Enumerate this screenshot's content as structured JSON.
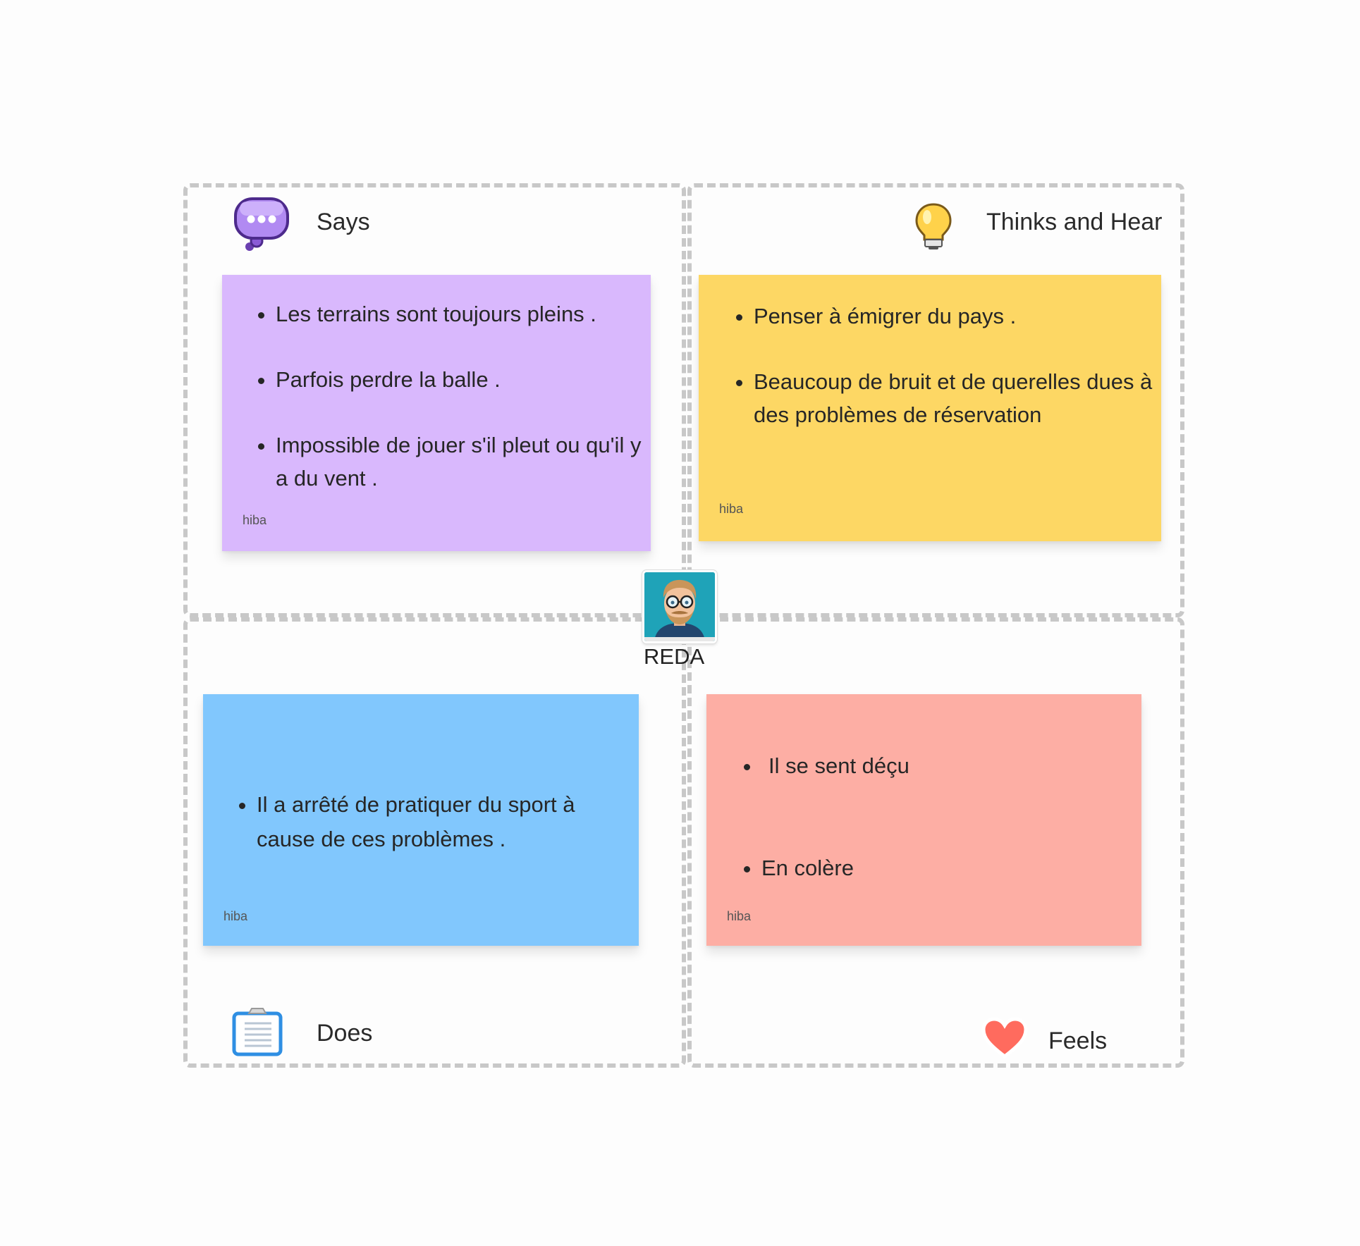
{
  "persona": {
    "name": "REDA",
    "avatar_icon": "man-with-glasses-avatar"
  },
  "quadrants": {
    "says": {
      "label": "Says",
      "icon": "speech-bubble-icon",
      "sticky": {
        "color": "#d9b8fd",
        "items": [
          "Les terrains sont toujours pleins .",
          "Parfois perdre la balle .",
          "Impossible de jouer s'il pleut ou qu'il y a du vent ."
        ],
        "author": "hiba"
      }
    },
    "thinks": {
      "label": "Thinks and Hear",
      "icon": "lightbulb-icon",
      "sticky": {
        "color": "#fdd764",
        "items": [
          "Penser à émigrer du pays .",
          "Beaucoup de bruit et de querelles dues à des problèmes de réservation"
        ],
        "author": "hiba"
      }
    },
    "does": {
      "label": "Does",
      "icon": "clipboard-icon",
      "sticky": {
        "color": "#81c7fd",
        "items": [
          "Il a arrêté de pratiquer du sport à cause de ces problèmes ."
        ],
        "author": "hiba"
      }
    },
    "feels": {
      "label": "Feels",
      "icon": "heart-icon",
      "sticky": {
        "color": "#fdaea4",
        "items": [
          "Il se sent déçu",
          "En colère"
        ],
        "author": "hiba"
      }
    }
  }
}
